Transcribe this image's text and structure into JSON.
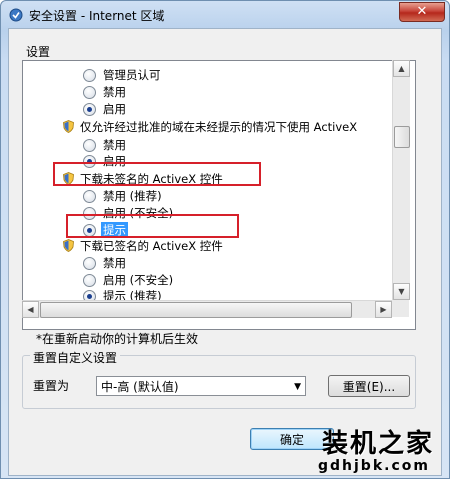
{
  "window": {
    "title": "安全设置 - Internet 区域",
    "close_label": "✕"
  },
  "settings": {
    "section_label": "设置",
    "rows": [
      {
        "kind": "radio",
        "label": "管理员认可",
        "checked": false
      },
      {
        "kind": "radio",
        "label": "禁用",
        "checked": false
      },
      {
        "kind": "radio",
        "label": "启用",
        "checked": true
      },
      {
        "kind": "header",
        "label": "仅允许经过批准的域在未经提示的情况下使用 ActiveX"
      },
      {
        "kind": "radio",
        "label": "禁用",
        "checked": false
      },
      {
        "kind": "radio",
        "label": "启用",
        "checked": true
      },
      {
        "kind": "header",
        "label": "下载未签名的 ActiveX 控件"
      },
      {
        "kind": "radio",
        "label": "禁用 (推荐)",
        "checked": false
      },
      {
        "kind": "radio",
        "label": "启用 (不安全)",
        "checked": false
      },
      {
        "kind": "radio",
        "label": "提示",
        "checked": true
      },
      {
        "kind": "header",
        "label": "下载已签名的 ActiveX 控件"
      },
      {
        "kind": "radio",
        "label": "禁用",
        "checked": false
      },
      {
        "kind": "radio",
        "label": "启用 (不安全)",
        "checked": false
      },
      {
        "kind": "radio",
        "label": "提示 (推荐)",
        "checked": true
      }
    ],
    "restart_note": "*在重新启动你的计算机后生效"
  },
  "reset": {
    "group_title": "重置自定义设置",
    "reset_to_label": "重置为",
    "selected_level": "中-高 (默认值)",
    "reset_button": "重置(E)..."
  },
  "footer": {
    "ok_button": "确定"
  },
  "watermark": {
    "name": "装机之家",
    "url": "gdhjbk.com"
  },
  "colors": {
    "highlight_box": "#d6202a",
    "selection": "#3399ff"
  }
}
